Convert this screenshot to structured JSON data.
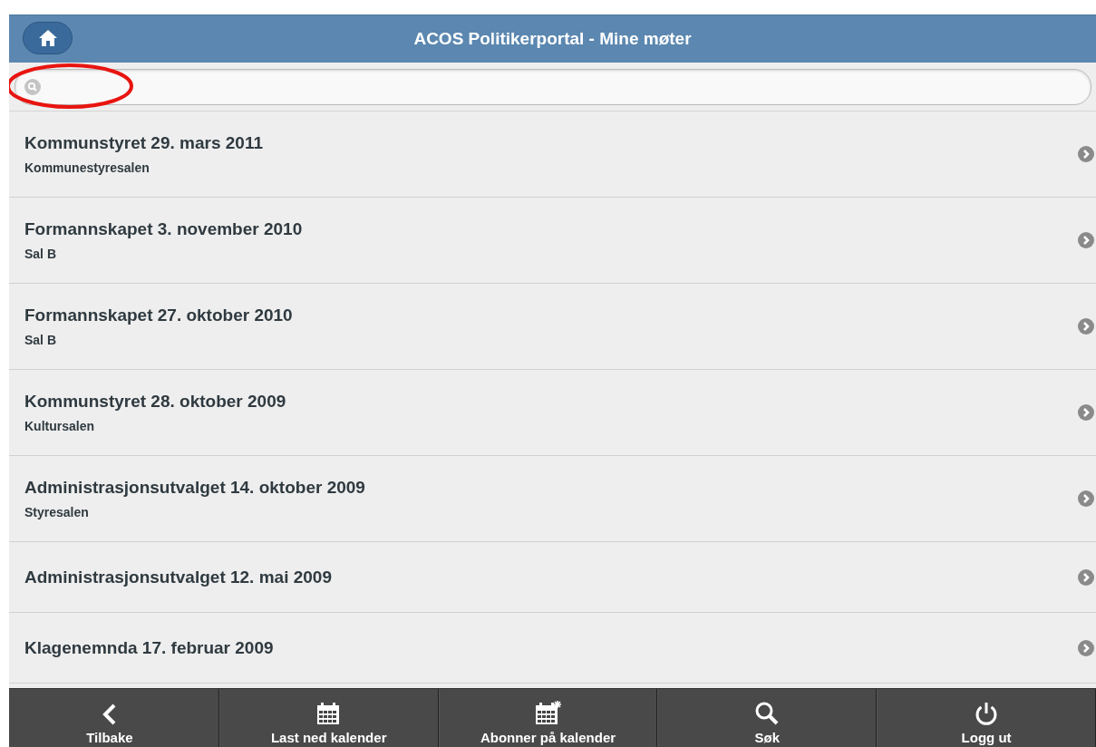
{
  "header": {
    "title": "ACOS Politikerportal - Mine møter"
  },
  "meetings": [
    {
      "title": "Kommunstyret 29. mars 2011",
      "location": "Kommunestyresalen"
    },
    {
      "title": "Formannskapet 3. november 2010",
      "location": "Sal B"
    },
    {
      "title": "Formannskapet 27. oktober 2010",
      "location": "Sal B"
    },
    {
      "title": "Kommunstyret 28. oktober 2009",
      "location": "Kultursalen"
    },
    {
      "title": "Administrasjonsutvalget 14. oktober 2009",
      "location": "Styresalen"
    },
    {
      "title": "Administrasjonsutvalget 12. mai 2009"
    },
    {
      "title": "Klagenemnda 17. februar 2009"
    }
  ],
  "footer": [
    {
      "kind": "back",
      "label": "Tilbake"
    },
    {
      "kind": "calendar",
      "label": "Last ned kalender"
    },
    {
      "kind": "subscribe",
      "label": "Abonner på kalender"
    },
    {
      "kind": "search",
      "label": "Søk"
    },
    {
      "kind": "power",
      "label": "Logg ut"
    }
  ]
}
